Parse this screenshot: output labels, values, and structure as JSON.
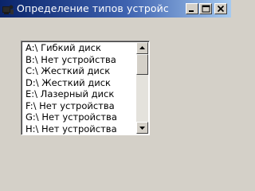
{
  "window": {
    "title": "Определение типов устройс"
  },
  "titlebar_buttons": {
    "minimize_icon": "minimize-icon",
    "maximize_icon": "maximize-icon",
    "close_icon": "close-icon"
  },
  "device_list": {
    "items": [
      "A:\\ Гибкий диск",
      "B:\\ Нет устройства",
      "C:\\ Жесткий диск",
      "D:\\ Жесткий диск",
      "E:\\ Лазерный диск",
      "F:\\ Нет устройства",
      "G:\\ Нет устройства",
      "H:\\ Нет устройства"
    ]
  },
  "scrollbar": {
    "up_icon": "arrow-up-icon",
    "down_icon": "arrow-down-icon",
    "position": 0
  },
  "colors": {
    "titlebar_start": "#0a246a",
    "titlebar_end": "#a6caf0",
    "window_face": "#d4d0c8",
    "list_background": "#ffffff"
  }
}
